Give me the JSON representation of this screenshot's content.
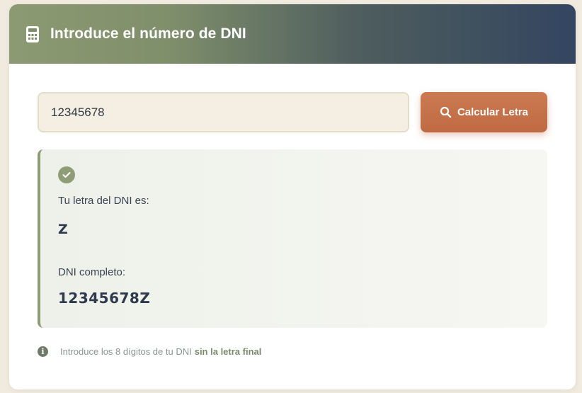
{
  "header": {
    "title": "Introduce el número de DNI",
    "icon": "calculator-icon"
  },
  "form": {
    "dni_value": "12345678",
    "button_label": "Calcular Letra",
    "button_icon": "search-icon"
  },
  "result": {
    "status_icon": "check-icon",
    "letter_label": "Tu letra del DNI es:",
    "letter_value": "Z",
    "full_label": "DNI completo:",
    "full_value": "12345678Z"
  },
  "hint": {
    "icon": "info-icon",
    "text": "Introduce los 8 dígitos de tu DNI",
    "strong_text": "sin la letra final"
  },
  "colors": {
    "accent_green": "#8f9d77",
    "button_orange": "#c4704a",
    "header_dark": "#334560"
  }
}
